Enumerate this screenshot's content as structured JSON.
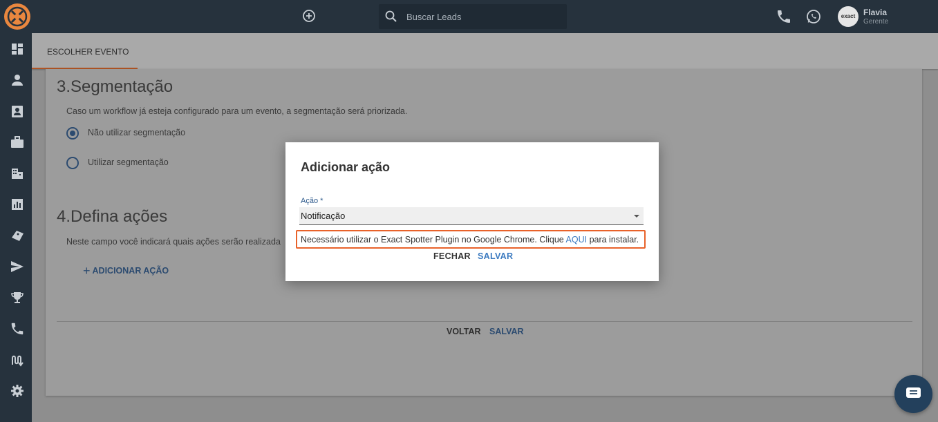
{
  "topbar": {
    "search_placeholder": "Buscar Leads",
    "user": {
      "name": "Flavia",
      "role": "Gerente",
      "avatar_text": "exact"
    }
  },
  "sidebar": {
    "items": [
      {
        "icon": "dashboard-icon"
      },
      {
        "icon": "person-icon"
      },
      {
        "icon": "contact-card-icon"
      },
      {
        "icon": "briefcase-icon"
      },
      {
        "icon": "building-icon"
      },
      {
        "icon": "bar-chart-icon"
      },
      {
        "icon": "tag-icon"
      },
      {
        "icon": "send-icon"
      },
      {
        "icon": "trophy-icon"
      },
      {
        "icon": "phone-icon"
      },
      {
        "icon": "route-icon"
      },
      {
        "icon": "gear-icon"
      }
    ]
  },
  "tabs": [
    {
      "label": "ESCOLHER EVENTO",
      "active": true
    }
  ],
  "segmentation": {
    "title": "3.Segmentação",
    "description": "Caso um workflow já esteja configurado para um evento, a segmentação será priorizada.",
    "options": [
      {
        "label": "Não utilizar segmentação",
        "checked": true
      },
      {
        "label": "Utilizar segmentação",
        "checked": false
      }
    ]
  },
  "actions": {
    "title": "4.Defina ações",
    "description": "Neste campo você indicará quais ações serão realizada",
    "add_label": "ADICIONAR AÇÃO"
  },
  "footer": {
    "back_label": "VOLTAR",
    "save_label": "SALVAR"
  },
  "modal": {
    "title": "Adicionar ação",
    "field_label": "Ação *",
    "selected_value": "Notificação",
    "warning_prefix": "Necessário utilizar o Exact Spotter Plugin no Google Chrome. Clique ",
    "warning_link": "AQUI",
    "warning_suffix": " para instalar.",
    "close_label": "FECHAR",
    "save_label": "SALVAR"
  },
  "colors": {
    "topbar": "#26323d",
    "accent_orange": "#e8622a",
    "link_blue": "#3b7ac0",
    "radio_blue": "#2c4b70"
  }
}
